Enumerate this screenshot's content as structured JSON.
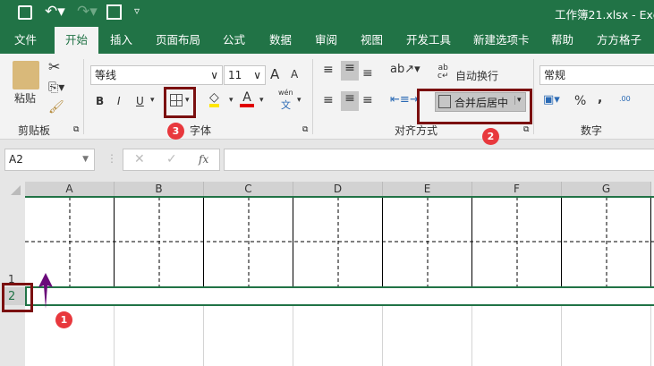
{
  "title_bar": {
    "title": "工作簿21.xlsx  -  Exc",
    "save_icon": "save-icon",
    "undo_icon": "undo-icon",
    "redo_icon": "redo-icon",
    "custom_icon": "form-icon",
    "qat_dropdown": "▿"
  },
  "tabs": [
    "文件",
    "开始",
    "插入",
    "页面布局",
    "公式",
    "数据",
    "审阅",
    "视图",
    "开发工具",
    "新建选项卡",
    "帮助",
    "方方格子"
  ],
  "active_tab": "开始",
  "ribbon": {
    "clipboard": {
      "paste": "粘贴",
      "label": "剪贴板"
    },
    "font": {
      "name": "等线",
      "size": "11",
      "bold": "B",
      "italic": "I",
      "underline": "U",
      "grow": "A",
      "shrink": "A",
      "font_color": "A",
      "phonetic_top": "wén",
      "phonetic_bottom": "文",
      "label": "字体"
    },
    "alignment": {
      "wrap_text": "自动换行",
      "merge_center": "合并后居中",
      "label": "对齐方式"
    },
    "number": {
      "format": "常规",
      "percent": "%",
      "comma": ",",
      "inc_decimal": ".00",
      "label": "数字"
    }
  },
  "formula_bar": {
    "name_box": "A2",
    "cancel": "✕",
    "enter": "✓",
    "fx": "fx",
    "formula": ""
  },
  "sheet": {
    "columns": [
      "A",
      "B",
      "C",
      "D",
      "E",
      "F",
      "G"
    ],
    "rows": [
      "1",
      "2"
    ],
    "selected_cell": "A2"
  },
  "annotations": {
    "badge1": "1",
    "badge2": "2",
    "badge3": "3"
  },
  "colors": {
    "excel_green": "#217346",
    "annotation_red": "#7b1010",
    "badge_red": "#e8383d",
    "arrow_purple": "#6a0a7a"
  }
}
